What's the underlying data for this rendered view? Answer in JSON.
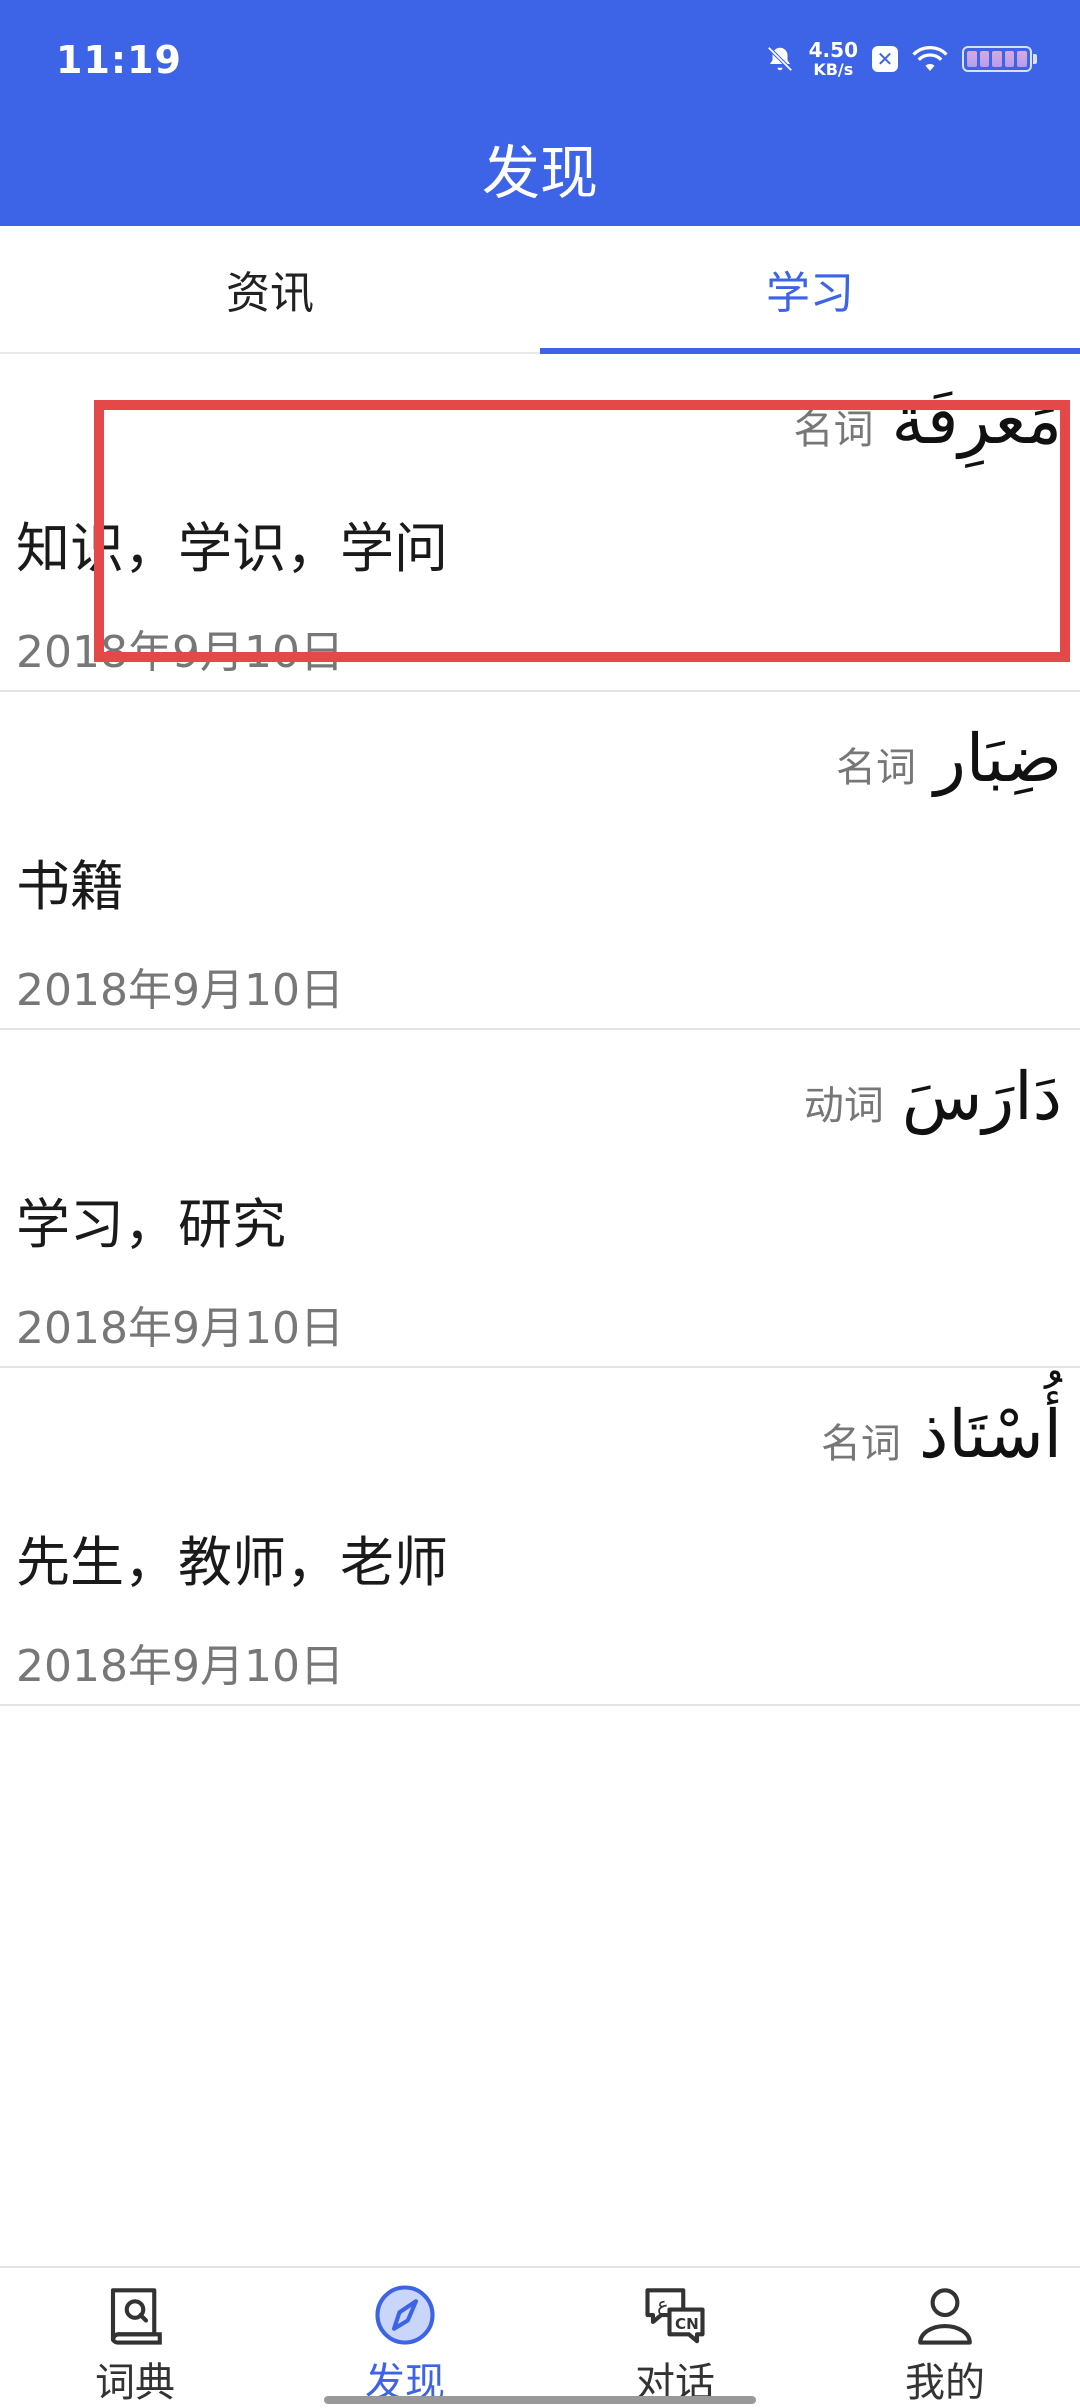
{
  "status_bar": {
    "time": "11:19",
    "speed_value": "4.50",
    "speed_unit": "KB/s",
    "icons": [
      "bell-muted-icon",
      "x-badge-icon",
      "wifi-icon",
      "battery-icon"
    ],
    "x_badge": "✕"
  },
  "header": {
    "title": "发现",
    "background_color": "#3D63E6"
  },
  "tabs": [
    {
      "label": "资讯",
      "active": false
    },
    {
      "label": "学习",
      "active": true
    }
  ],
  "items": [
    {
      "arabic": "مَعرِفَة",
      "pos": "名词",
      "meaning": "知识，学识，学问",
      "date": "2018年9月10日"
    },
    {
      "arabic": "ضِبَار",
      "pos": "名词",
      "meaning": "书籍",
      "date": "2018年9月10日"
    },
    {
      "arabic": "دَارَسَ",
      "pos": "动词",
      "meaning": "学习，研究",
      "date": "2018年9月10日"
    },
    {
      "arabic": "أُسْتَاذ",
      "pos": "名词",
      "meaning": "先生，教师，老师",
      "date": "2018年9月10日"
    }
  ],
  "bottom_nav": [
    {
      "label": "词典",
      "icon": "dictionary-icon",
      "active": false
    },
    {
      "label": "发现",
      "icon": "compass-icon",
      "active": true
    },
    {
      "label": "对话",
      "icon": "chat-cn-icon",
      "active": false
    },
    {
      "label": "我的",
      "icon": "profile-icon",
      "active": false
    }
  ],
  "accent_color": "#3D63E6",
  "highlight_color": "#E54848"
}
